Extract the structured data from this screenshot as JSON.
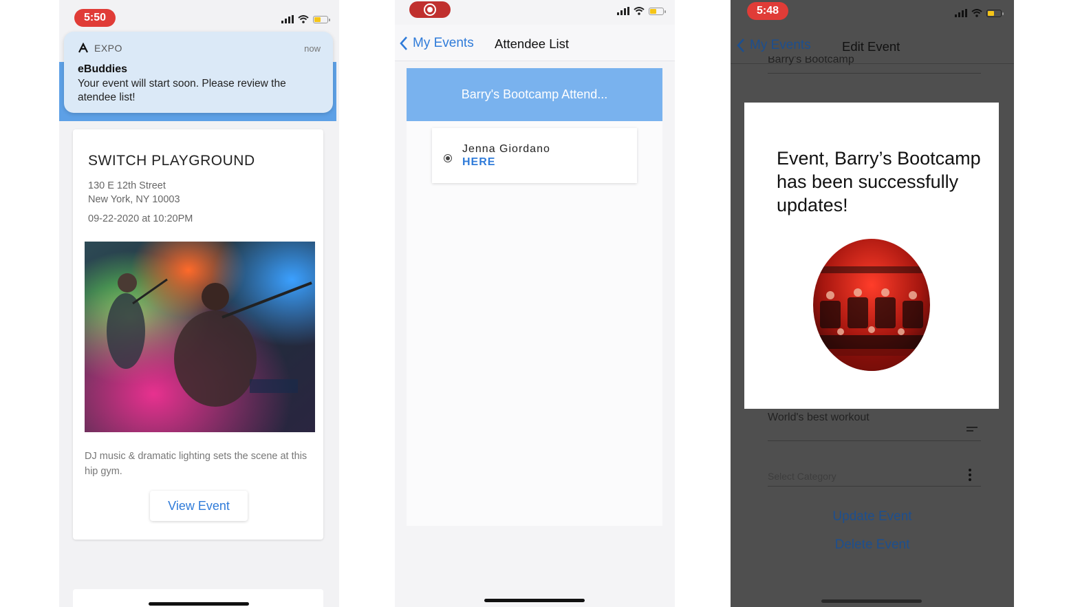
{
  "phone1": {
    "time": "5:50",
    "notification": {
      "app_name": "EXPO",
      "time": "now",
      "title": "eBuddies",
      "body": "Your event will start soon. Please review the atendee list!"
    },
    "event": {
      "title": "SWITCH PLAYGROUND",
      "address_line1": "130 E 12th Street",
      "address_line2": "New York, NY 10003",
      "datetime": "09-22-2020 at 10:20PM",
      "description": "DJ music & dramatic lighting sets the scene at this hip gym.",
      "button_label": "View Event"
    }
  },
  "phone2": {
    "back_label": "My Events",
    "title": "Attendee List",
    "header": "Barry's Bootcamp Attend...",
    "attendees": [
      {
        "name": "Jenna  Giordano",
        "status": "HERE"
      }
    ]
  },
  "phone3": {
    "time": "5:48",
    "back_label": "My Events",
    "title": "Edit Event",
    "field_event_name": "Barry's Bootcamp",
    "field_description": "World's best workout",
    "category_placeholder": "Select Category",
    "update_label": "Update Event",
    "delete_label": "Delete Event",
    "modal_message": "Event, Barry’s Bootcamp  has been successfully updates!"
  },
  "colors": {
    "accent_blue": "#2f7bd9",
    "header_blue": "#79b2ee",
    "time_pill_red": "#e03c37",
    "overlay_gray": "#4f4f4f"
  },
  "icons": [
    "signal-icon",
    "wifi-icon",
    "battery-icon",
    "chevron-left-icon",
    "record-icon",
    "menu-lines-icon",
    "more-vertical-icon",
    "expo-logo-icon",
    "radio-icon"
  ]
}
